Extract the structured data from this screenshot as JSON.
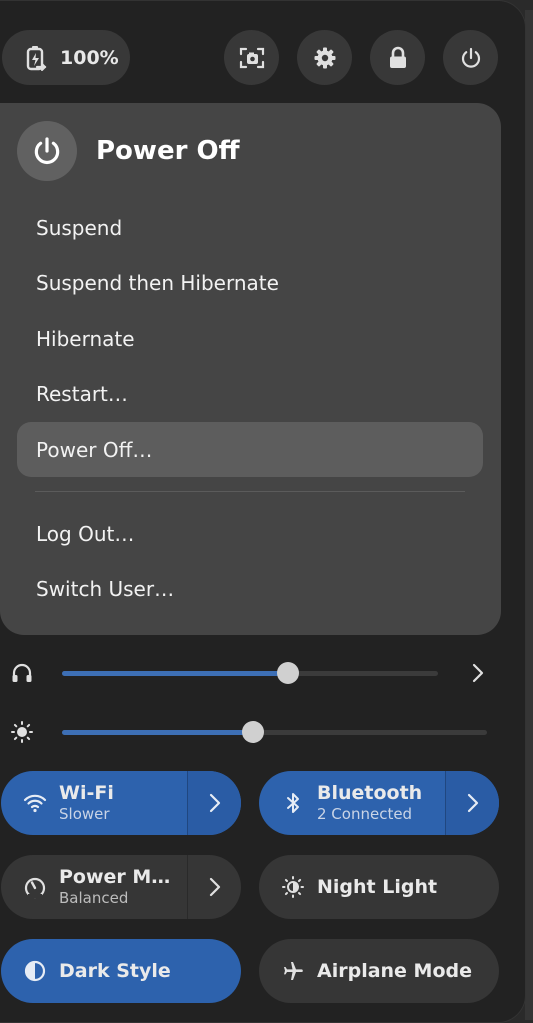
{
  "topbar": {
    "battery_text": "100%",
    "icons": [
      "battery-charging-icon",
      "screenshot-icon",
      "settings-icon",
      "lock-icon",
      "power-icon"
    ]
  },
  "power_menu": {
    "title": "Power Off",
    "items": [
      {
        "label": "Suspend"
      },
      {
        "label": "Suspend then Hibernate"
      },
      {
        "label": "Hibernate"
      },
      {
        "label": "Restart…"
      },
      {
        "label": "Power Off…",
        "selected": true
      },
      {
        "label": "Log Out…"
      },
      {
        "label": "Switch User…"
      }
    ]
  },
  "sliders": {
    "volume": {
      "icon": "headphones-icon",
      "level": 0.6
    },
    "brightness": {
      "icon": "brightness-icon",
      "level": 0.45
    }
  },
  "toggles": {
    "wifi": {
      "title": "Wi-Fi",
      "subtitle": "Slower",
      "active": true
    },
    "bluetooth": {
      "title": "Bluetooth",
      "subtitle": "2 Connected",
      "active": true
    },
    "power_mode": {
      "title": "Power M…",
      "subtitle": "Balanced",
      "active": false
    },
    "night_light": {
      "title": "Night Light",
      "active": false
    },
    "dark_style": {
      "title": "Dark Style",
      "active": true
    },
    "airplane_mode": {
      "title": "Airplane Mode",
      "active": false
    }
  },
  "colors": {
    "accent": "#2d62ad",
    "panel": "#222222",
    "menu": "#454545"
  }
}
